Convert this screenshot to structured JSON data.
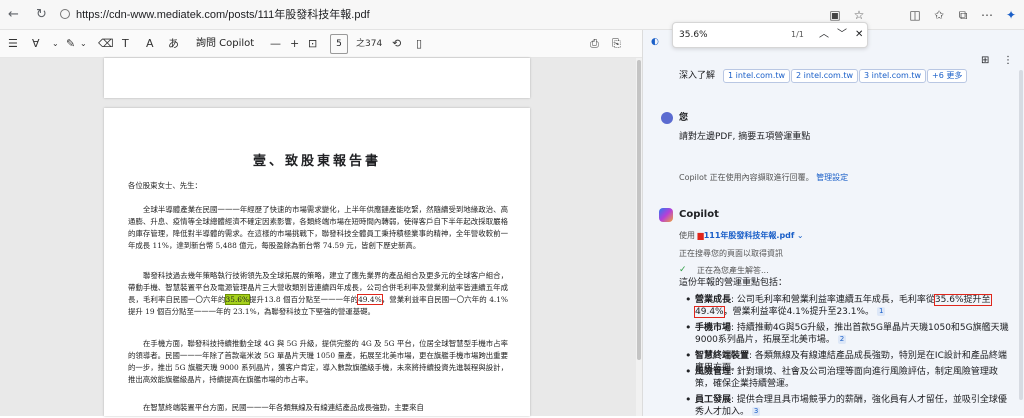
{
  "browser": {
    "url": "https://cdn-www.mediatek.com/posts/111年股發科技年報.pdf"
  },
  "pdf_toolbar": {
    "copilot_label": "詢問 Copilot",
    "zoom_minus": "—",
    "zoom_plus": "+",
    "page_current": "5",
    "page_total": "之374"
  },
  "pdf": {
    "title": "壹、致股東報告書",
    "greeting": "各位股東女士、先生：",
    "para1": "全球半導體產業在民國一一一年經歷了快速的市場需求變化，上半年供應鏈產能吃緊，然隨續受到地緣政治、高通膨、升息、疫情等全球總體經濟不確定因素影響，各類終端市場在短時間內轉弱，使得客戶自下半年起改採取嚴格的庫存管理，降低對半導體的需求。在這樣的市場挑戰下，聯發科技全體員工秉持積極業事的精神，全年營收較前一年成長 11%，達到新台幣 5,488 億元，每股盈餘為新台幣 74.59 元，皆創下歷史新高。",
    "para2_a": "聯發科技過去幾年策略執行技術領先及全球拓展的策略，建立了應先業界的產品組合及更多元的全球客户組合，帶動手機、智慧裝置平台及電源管理晶片三大營收類別皆連續四年成長，公司合併毛利率及營業利益率皆連續五年成長，毛利率自民國一〇六年的",
    "para2_hl": "35.6%",
    "para2_b": "提升13.8 個百分點至一一一年的",
    "para2_box": "49.4%",
    "para2_c": "，營業利益率自民國一〇六年的 4.1%提升 19 個百分點至一一一年的 23.1%，為聯發科技立下堅強的營運基礎。",
    "para3": "在手機方面，聯發科技持續推動全球 4G 與 5G 升級，提供完整的 4G 及 5G 平台，位居全球智慧型手機市占率的領導者。民國一一一年除了首款毫米波 5G 單晶片天璣 1050 量產，拓展至北美市場，更在旗艦手機市場跨出重要的一步，推出 5G 旗艦天璣 9000 系列晶片，獲客户肯定，導入數款旗艦級手機，未來將持續投資先進製程與設計，推出高效能旗艦級晶片，持續提高在旗艦市場的市占率。",
    "para4": "在智慧終端裝置平台方面，民國一一一年各類無線及有線連結產品成長強勁，主要來自"
  },
  "find_bar": {
    "query": "35.6%",
    "count": "1/1"
  },
  "side_panel": {
    "learn_more": "深入了解",
    "refs": [
      "1 intel.com.tw",
      "2 intel.com.tw",
      "3 intel.com.tw"
    ],
    "refs_more": "+6 更多",
    "user_name": "您",
    "user_message": "請對左邊PDF, 摘要五項營運重點",
    "context_note": "Copilot 正在使用內容擷取進行回覆。",
    "context_link": "管理設定",
    "copilot_name": "Copilot",
    "used_prefix": "使用",
    "used_file": "111年股發科技年報.pdf",
    "searching": "正在搜尋您的頁面以取得資訊",
    "generating": "正在為您產生解答...",
    "intro": "這份年報的營運重點包括：",
    "items": [
      {
        "head": "營業成長",
        "text_a": ": 公司毛利率和營業利益率連續五年成長，毛利率從",
        "box": "35.6%提升至49.4%",
        "text_b": "，營業利益率從4.1%提升至23.1%。",
        "cite": "1"
      },
      {
        "head": "手機市場",
        "text": ": 持續推動4G與5G升級，推出首款5G單晶片天璣1050和5G旗艦天璣9000系列晶片，拓展至北美市場。",
        "cite": "2"
      },
      {
        "head": "智慧終端裝置",
        "text": ": 各類無線及有線連結產品成長強勁，特別是在IC設計和產品終端應用方面。",
        "cite": ""
      },
      {
        "head": "風險管理",
        "text": ": 針對環境、社會及公司治理等面向進行風險評估，制定風險管理政策，確保企業持續營運。",
        "cite": ""
      },
      {
        "head": "員工發展",
        "text": ": 提供合理且具市場競爭力的薪酬，強化員有人才留任，並吸引全球優秀人才加入。",
        "cite": "3"
      }
    ]
  },
  "colors": {
    "highlight": "#a5d11b",
    "box_red": "#e0261b",
    "link": "#1a5fc8"
  }
}
